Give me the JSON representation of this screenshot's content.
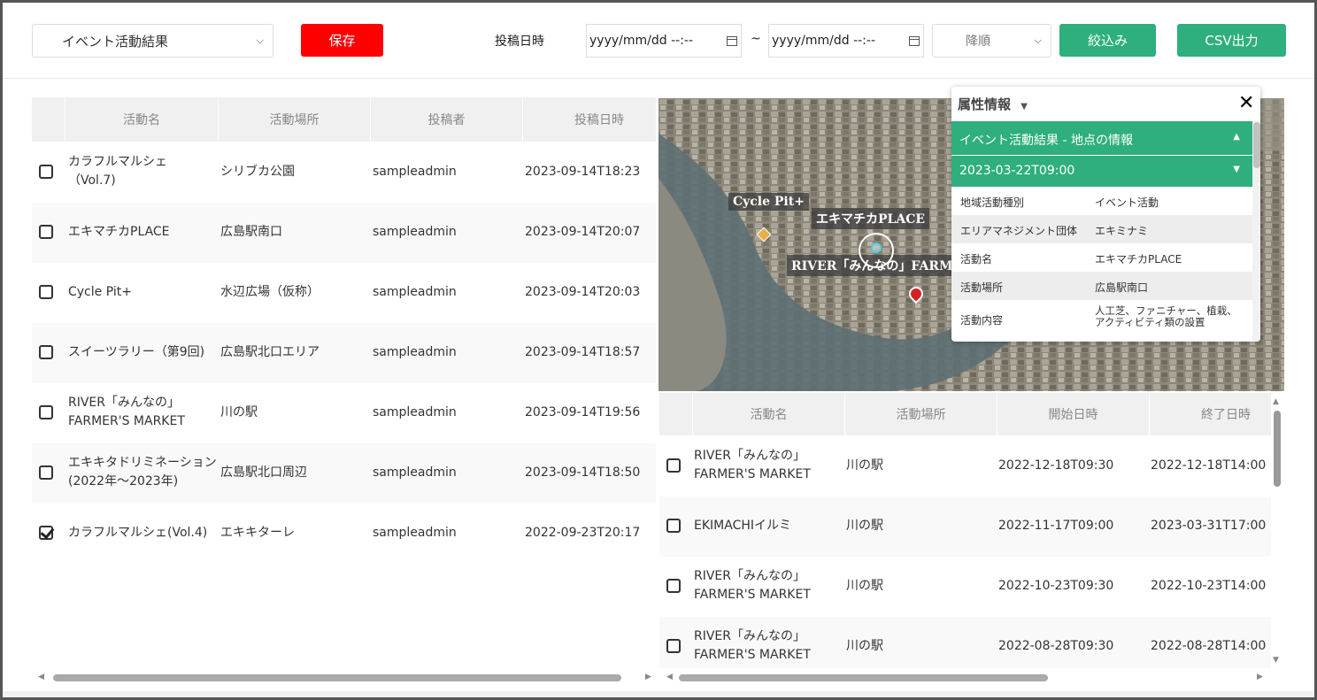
{
  "toolbar": {
    "layer_select": "イベント活動結果",
    "save_label": "保存",
    "posted_label": "投稿日時",
    "date_from": "yyyy/mm/dd --:--",
    "tilde": "~",
    "date_to": "yyyy/mm/dd --:--",
    "order_select": "降順",
    "filter_label": "絞込み",
    "csv_label": "CSV出力"
  },
  "colors": {
    "save": "#ff0000",
    "accent": "#2eaf7d"
  },
  "left_table": {
    "headers": [
      "活動名",
      "活動場所",
      "投稿者",
      "投稿日時"
    ],
    "rows": [
      {
        "name": "カラフルマルシェ（Vol.7)",
        "name1": "カラフルマルシェ",
        "name2": "（Vol.7)",
        "place": "シリブカ公園",
        "poster": "sampleadmin",
        "date": "2023-09-14T18:23",
        "checked": false
      },
      {
        "name1": "エキマチカPLACE",
        "name2": "",
        "place": "広島駅南口",
        "poster": "sampleadmin",
        "date": "2023-09-14T20:07",
        "checked": false
      },
      {
        "name1": "Cycle Pit+",
        "name2": "",
        "place": "水辺広場（仮称）",
        "poster": "sampleadmin",
        "date": "2023-09-14T20:03",
        "checked": false
      },
      {
        "name1": "スイーツラリー（第9回)",
        "name2": "",
        "place": "広島駅北口エリア",
        "poster": "sampleadmin",
        "date": "2023-09-14T18:57",
        "checked": false
      },
      {
        "name1": "RIVER「みんなの」",
        "name2": "FARMER'S MARKET",
        "place": "川の駅",
        "poster": "sampleadmin",
        "date": "2023-09-14T19:56",
        "checked": false
      },
      {
        "name1": "エキキタドリミネーション",
        "name2": "(2022年～2023年)",
        "place": "広島駅北口周辺",
        "poster": "sampleadmin",
        "date": "2023-09-14T18:50",
        "checked": false
      },
      {
        "name1": "カラフルマルシェ(Vol.4)",
        "name2": "",
        "place": "エキキターレ",
        "poster": "sampleadmin",
        "date": "2022-09-23T20:17",
        "checked": true
      }
    ]
  },
  "map": {
    "labels": [
      "Cycle Pit+",
      "エキマチカPLACE",
      "RIVER「みんなの」FARMER'S MARKET"
    ]
  },
  "popup": {
    "title": "属性情報",
    "section": "イベント活動結果 - 地点の情報",
    "subsection": "2023-03-22T09:00",
    "fields": [
      {
        "k": "地域活動種別",
        "v": "イベント活動"
      },
      {
        "k": "エリアマネジメント団体",
        "v": "エキミナミ"
      },
      {
        "k": "活動名",
        "v": "エキマチカPLACE"
      },
      {
        "k": "活動場所",
        "v": "広島駅南口"
      },
      {
        "k": "活動内容",
        "v": "人工芝、ファニチャー、植栽、アクティビティ類の設置"
      }
    ]
  },
  "right_table": {
    "headers": [
      "活動名",
      "活動場所",
      "開始日時",
      "終了日時"
    ],
    "rows": [
      {
        "name1": "RIVER「みんなの」",
        "name2": "FARMER'S MARKET",
        "place": "川の駅",
        "start": "2022-12-18T09:30",
        "end": "2022-12-18T14:00"
      },
      {
        "name1": "EKIMACHIイルミ",
        "name2": "",
        "place": "川の駅",
        "start": "2022-11-17T09:00",
        "end": "2023-03-31T17:00"
      },
      {
        "name1": "RIVER「みんなの」",
        "name2": "FARMER'S MARKET",
        "place": "川の駅",
        "start": "2022-10-23T09:30",
        "end": "2022-10-23T14:00"
      },
      {
        "name1": "RIVER「みんなの」",
        "name2": "FARMER'S MARKET",
        "place": "川の駅",
        "start": "2022-08-28T09:30",
        "end": "2022-08-28T14:00"
      }
    ]
  }
}
